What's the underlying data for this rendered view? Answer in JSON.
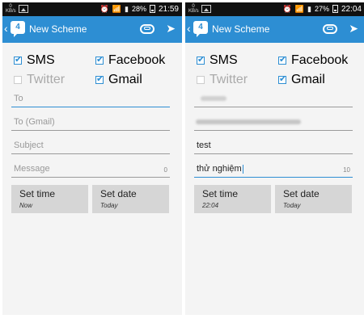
{
  "screens": [
    {
      "statusbar": {
        "kbs": "0 KB/s",
        "battery_pct": "28%",
        "time": "21:59"
      },
      "actionbar": {
        "app_badge": "4",
        "title": "New Scheme"
      },
      "checkboxes": [
        {
          "label": "SMS",
          "checked": true,
          "disabled": false
        },
        {
          "label": "Facebook",
          "checked": true,
          "disabled": false
        },
        {
          "label": "Twitter",
          "checked": false,
          "disabled": true
        },
        {
          "label": "Gmail",
          "checked": true,
          "disabled": false
        }
      ],
      "fields": {
        "to": {
          "placeholder": "To",
          "value": ""
        },
        "to_gmail": {
          "placeholder": "To (Gmail)",
          "value": ""
        },
        "subject": {
          "placeholder": "Subject",
          "value": ""
        },
        "message": {
          "placeholder": "Message",
          "value": "",
          "count": "0"
        }
      },
      "buttons": {
        "set_time": {
          "label": "Set time",
          "value": "Now"
        },
        "set_date": {
          "label": "Set date",
          "value": "Today"
        }
      }
    },
    {
      "statusbar": {
        "kbs": "0 KB/s",
        "battery_pct": "27%",
        "time": "22:04"
      },
      "actionbar": {
        "app_badge": "4",
        "title": "New Scheme"
      },
      "checkboxes": [
        {
          "label": "SMS",
          "checked": true,
          "disabled": false
        },
        {
          "label": "Facebook",
          "checked": true,
          "disabled": false
        },
        {
          "label": "Twitter",
          "checked": false,
          "disabled": true
        },
        {
          "label": "Gmail",
          "checked": true,
          "disabled": false
        }
      ],
      "fields": {
        "to": {
          "value": ""
        },
        "to_gmail": {
          "value": ""
        },
        "subject": {
          "value": "test"
        },
        "message": {
          "value": "thử nghiệm",
          "count": "10"
        }
      },
      "buttons": {
        "set_time": {
          "label": "Set time",
          "value": "22:04"
        },
        "set_date": {
          "label": "Set date",
          "value": "Today"
        }
      }
    }
  ]
}
